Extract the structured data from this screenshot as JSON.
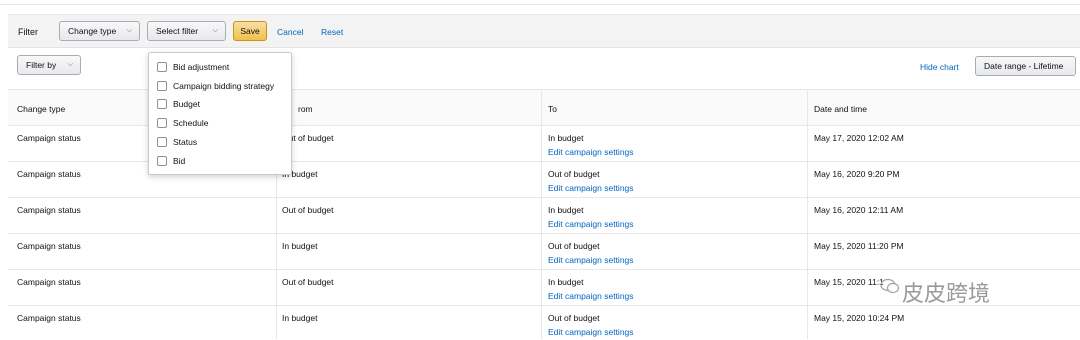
{
  "filter_bar": {
    "label": "Filter",
    "change_type_button": "Change type",
    "select_filter_button": "Select filter",
    "save_button": "Save",
    "cancel_link": "Cancel",
    "reset_link": "Reset"
  },
  "subbar": {
    "filter_by_button": "Filter by",
    "hide_chart_link": "Hide chart",
    "date_range_button": "Date range - Lifetime"
  },
  "dropdown_options": [
    {
      "label": "Bid adjustment",
      "checked": false
    },
    {
      "label": "Campaign bidding strategy",
      "checked": false
    },
    {
      "label": "Budget",
      "checked": false
    },
    {
      "label": "Schedule",
      "checked": false
    },
    {
      "label": "Status",
      "checked": false
    },
    {
      "label": "Bid",
      "checked": false
    }
  ],
  "table": {
    "headers": [
      "Change type",
      "rom",
      "To",
      "Date and time"
    ],
    "edit_link": "Edit campaign settings",
    "rows": [
      {
        "type": "Campaign status",
        "from": "Out of budget",
        "to": "In budget",
        "date": "May 17, 2020 12:02 AM"
      },
      {
        "type": "Campaign status",
        "from": "In budget",
        "to": "Out of budget",
        "date": "May 16, 2020 9:20 PM"
      },
      {
        "type": "Campaign status",
        "from": "Out of budget",
        "to": "In budget",
        "date": "May 16, 2020 12:11 AM"
      },
      {
        "type": "Campaign status",
        "from": "In budget",
        "to": "Out of budget",
        "date": "May 15, 2020 11:20 PM"
      },
      {
        "type": "Campaign status",
        "from": "Out of budget",
        "to": "In budget",
        "date": "May 15, 2020 11:1"
      },
      {
        "type": "Campaign status",
        "from": "In budget",
        "to": "Out of budget",
        "date": "May 15, 2020 10:24 PM"
      }
    ]
  },
  "watermark": "皮皮跨境",
  "colors": {
    "link": "#0066c0",
    "save": "#f0c14b"
  }
}
